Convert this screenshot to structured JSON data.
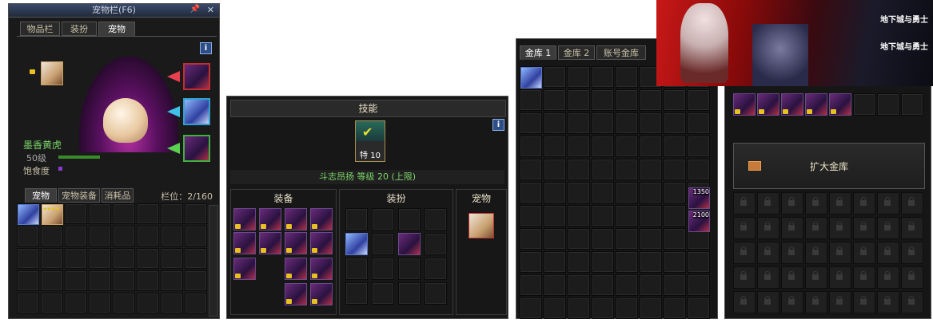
{
  "pet_window": {
    "title": "宠物栏(F6)",
    "tabs": [
      "物品栏",
      "装扮",
      "宠物"
    ],
    "pet_name": "墨香黄虎",
    "pet_level": "50级",
    "satiety_label": "饱食度",
    "bottom_tabs": [
      "宠物",
      "宠物装备",
      "消耗品"
    ],
    "slot_count": "栏位：2/160",
    "info_label": "i",
    "pin_icon": "pin-icon",
    "close_label": "✕",
    "stars": "★★★★"
  },
  "skill_window": {
    "header": "技能",
    "skill_tag": "特 10",
    "skill_text": "斗志昂扬 等级 20 (上限)",
    "col_equip": "装备",
    "col_avatar": "装扮",
    "col_pet": "宠物",
    "info_label": "i"
  },
  "vault_window": {
    "tabs": [
      "金库 1",
      "金库 2",
      "账号金库"
    ],
    "badge_1": "1350",
    "badge_2": "2100"
  },
  "account_vault": {
    "expand_button": "扩大金库",
    "banner_logo_1": "地下城与勇士",
    "banner_logo_2": "地下城与勇士"
  },
  "colors": {
    "accent_green": "#7cd66a",
    "gold": "#e8c020",
    "panel_bg": "#141414"
  }
}
